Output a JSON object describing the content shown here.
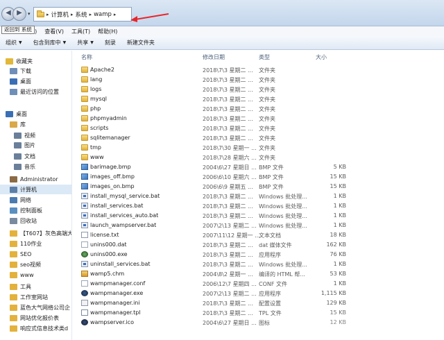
{
  "address": {
    "crumbs": [
      "计算机",
      "系统",
      "wamp"
    ],
    "separator": "▸"
  },
  "tooltip": {
    "text": "返回到 系统"
  },
  "menu": {
    "items": [
      "(E)",
      "查看(V)",
      "工具(T)",
      "帮助(H)"
    ]
  },
  "toolbar": {
    "organize": "组织",
    "include_library": "包含到库中",
    "share": "共享",
    "burn": "刻录",
    "new_folder": "新建文件夹"
  },
  "sidebar": {
    "items": [
      {
        "label": "收藏夹",
        "icon": "star-icon",
        "color": "#e2b83a"
      },
      {
        "label": "下载",
        "icon": "download-folder-icon",
        "color": "#6f8fb8"
      },
      {
        "label": "桌面",
        "icon": "desktop-icon",
        "color": "#3b6fb5"
      },
      {
        "label": "最近访问的位置",
        "icon": "recent-places-icon",
        "color": "#6f8fb8"
      },
      {
        "label": "桌面",
        "icon": "desktop-icon",
        "color": "#3b6fb5"
      },
      {
        "label": "库",
        "icon": "library-icon",
        "color": "#d9a94a"
      },
      {
        "label": "视频",
        "icon": "video-library-icon",
        "color": "#6a7f99"
      },
      {
        "label": "图片",
        "icon": "pictures-library-icon",
        "color": "#6a7f99"
      },
      {
        "label": "文档",
        "icon": "documents-library-icon",
        "color": "#6a7f99"
      },
      {
        "label": "音乐",
        "icon": "music-library-icon",
        "color": "#6a7f99"
      },
      {
        "label": "Administrator",
        "icon": "user-icon",
        "color": "#8b6b45"
      },
      {
        "label": "计算机",
        "icon": "computer-icon",
        "color": "#5c7fa8"
      },
      {
        "label": "网络",
        "icon": "network-icon",
        "color": "#4c7bb0"
      },
      {
        "label": "控制面板",
        "icon": "control-panel-icon",
        "color": "#5a8fc0"
      },
      {
        "label": "回收站",
        "icon": "recycle-bin-icon",
        "color": "#7a8aa0"
      },
      {
        "label": "【T607】灰色高端大",
        "icon": "folder-icon",
        "color": "#e3b23c"
      },
      {
        "label": "110作业",
        "icon": "folder-icon",
        "color": "#e3b23c"
      },
      {
        "label": "SEO",
        "icon": "folder-icon",
        "color": "#e3b23c"
      },
      {
        "label": "seo视频",
        "icon": "folder-icon",
        "color": "#e3b23c"
      },
      {
        "label": "www",
        "icon": "folder-icon",
        "color": "#e3b23c"
      },
      {
        "label": "工具",
        "icon": "folder-icon",
        "color": "#e3b23c"
      },
      {
        "label": "工作室网站",
        "icon": "folder-icon",
        "color": "#e3b23c"
      },
      {
        "label": "蓝色大气网络公司企",
        "icon": "folder-icon",
        "color": "#e3b23c"
      },
      {
        "label": "网站优化报价表",
        "icon": "folder-icon",
        "color": "#e3b23c"
      },
      {
        "label": "响应式信息技术类d",
        "icon": "folder-icon",
        "color": "#e3b23c"
      }
    ]
  },
  "columns": {
    "name": "名称",
    "date": "修改日期",
    "type": "类型",
    "size": "大小"
  },
  "files": [
    {
      "name": "Apache2",
      "date": "2018\\7\\3 星期二 ...",
      "type": "文件夹",
      "size": "",
      "icon": "folder"
    },
    {
      "name": "lang",
      "date": "2018\\7\\3 星期二 ...",
      "type": "文件夹",
      "size": "",
      "icon": "folder"
    },
    {
      "name": "logs",
      "date": "2018\\7\\3 星期二 ...",
      "type": "文件夹",
      "size": "",
      "icon": "folder"
    },
    {
      "name": "mysql",
      "date": "2018\\7\\3 星期二 ...",
      "type": "文件夹",
      "size": "",
      "icon": "folder"
    },
    {
      "name": "php",
      "date": "2018\\7\\3 星期二 ...",
      "type": "文件夹",
      "size": "",
      "icon": "folder"
    },
    {
      "name": "phpmyadmin",
      "date": "2018\\7\\3 星期二 ...",
      "type": "文件夹",
      "size": "",
      "icon": "folder"
    },
    {
      "name": "scripts",
      "date": "2018\\7\\3 星期二 ...",
      "type": "文件夹",
      "size": "",
      "icon": "folder"
    },
    {
      "name": "sqlitemanager",
      "date": "2018\\7\\3 星期二 ...",
      "type": "文件夹",
      "size": "",
      "icon": "folder"
    },
    {
      "name": "tmp",
      "date": "2018\\7\\30 星期一 ...",
      "type": "文件夹",
      "size": "",
      "icon": "folder"
    },
    {
      "name": "www",
      "date": "2018\\7\\28 星期六 ...",
      "type": "文件夹",
      "size": "",
      "icon": "folder"
    },
    {
      "name": "barimage.bmp",
      "date": "2004\\6\\27 星期日 ...",
      "type": "BMP 文件",
      "size": "5 KB",
      "icon": "bmp"
    },
    {
      "name": "images_off.bmp",
      "date": "2006\\6\\10 星期六 ...",
      "type": "BMP 文件",
      "size": "15 KB",
      "icon": "bmp"
    },
    {
      "name": "images_on.bmp",
      "date": "2006\\6\\9 星期五 ...",
      "type": "BMP 文件",
      "size": "15 KB",
      "icon": "bmp"
    },
    {
      "name": "install_mysql_service.bat",
      "date": "2018\\7\\3 星期二 ...",
      "type": "Windows 批处理...",
      "size": "1 KB",
      "icon": "bat"
    },
    {
      "name": "install_services.bat",
      "date": "2018\\7\\3 星期二 ...",
      "type": "Windows 批处理...",
      "size": "1 KB",
      "icon": "bat"
    },
    {
      "name": "install_services_auto.bat",
      "date": "2018\\7\\3 星期二 ...",
      "type": "Windows 批处理...",
      "size": "1 KB",
      "icon": "bat"
    },
    {
      "name": "launch_wampserver.bat",
      "date": "2007\\2\\13 星期二 ...",
      "type": "Windows 批处理...",
      "size": "1 KB",
      "icon": "bat"
    },
    {
      "name": "license.txt",
      "date": "2007\\11\\12 星期一 ...",
      "type": "文本文档",
      "size": "18 KB",
      "icon": "txt"
    },
    {
      "name": "unins000.dat",
      "date": "2018\\7\\3 星期二 ...",
      "type": "dat 媒体文件",
      "size": "162 KB",
      "icon": "dat"
    },
    {
      "name": "unins000.exe",
      "date": "2018\\7\\3 星期二 ...",
      "type": "应用程序",
      "size": "76 KB",
      "icon": "exe"
    },
    {
      "name": "uninstall_services.bat",
      "date": "2018\\7\\3 星期二 ...",
      "type": "Windows 批处理...",
      "size": "1 KB",
      "icon": "bat"
    },
    {
      "name": "wamp5.chm",
      "date": "2004\\8\\2 星期一 ...",
      "type": "编译的 HTML 帮...",
      "size": "53 KB",
      "icon": "chm"
    },
    {
      "name": "wampmanager.conf",
      "date": "2006\\12\\7 星期四 ...",
      "type": "CONF 文件",
      "size": "1 KB",
      "icon": "conf"
    },
    {
      "name": "wampmanager.exe",
      "date": "2007\\2\\13 星期二 ...",
      "type": "应用程序",
      "size": "1,115 KB",
      "icon": "wamp"
    },
    {
      "name": "wampmanager.ini",
      "date": "2018\\7\\3 星期二 ...",
      "type": "配置设置",
      "size": "129 KB",
      "icon": "ini"
    },
    {
      "name": "wampmanager.tpl",
      "date": "2018\\7\\3 星期二 ...",
      "type": "TPL 文件",
      "size": "15 KB",
      "icon": "tpl"
    },
    {
      "name": "wampserver.ico",
      "date": "2004\\6\\27 星期日 ...",
      "type": "图标",
      "size": "12 KB",
      "icon": "ico"
    }
  ]
}
